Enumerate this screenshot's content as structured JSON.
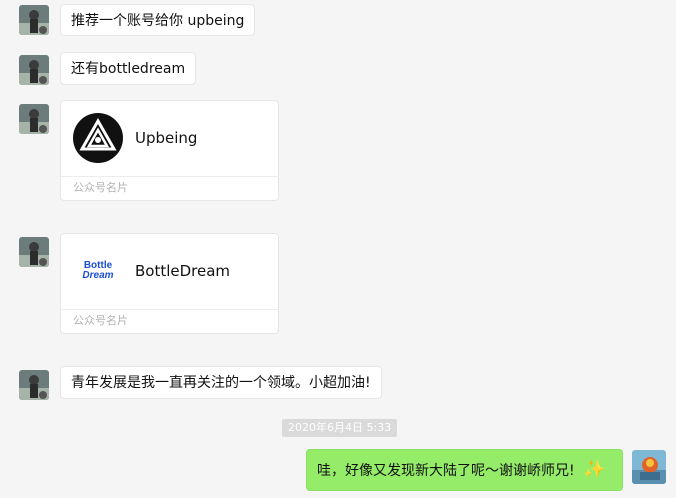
{
  "messages": {
    "m1": "推荐一个账号给你 upbeing",
    "m2": "还有bottledream",
    "m3": "青年发展是我一直再关注的一个领域。小超加油!"
  },
  "cards": [
    {
      "name": "Upbeing",
      "logo_icon": "upbeing-logo-icon",
      "footer": "公众号名片"
    },
    {
      "name": "BottleDream",
      "logo_text_top": "Bottle",
      "logo_text_bottom": "Dream",
      "footer": "公众号名片"
    }
  ],
  "timestamp": "2020年6月4日 5:33",
  "reply": {
    "text": "哇，好像又发现新大陆了呢～谢谢峤师兄!",
    "emoji": "✨"
  },
  "colors": {
    "self_bubble": "#95ec69",
    "background": "#f5f5f5",
    "bottledream_blue": "#1a4fd0"
  }
}
